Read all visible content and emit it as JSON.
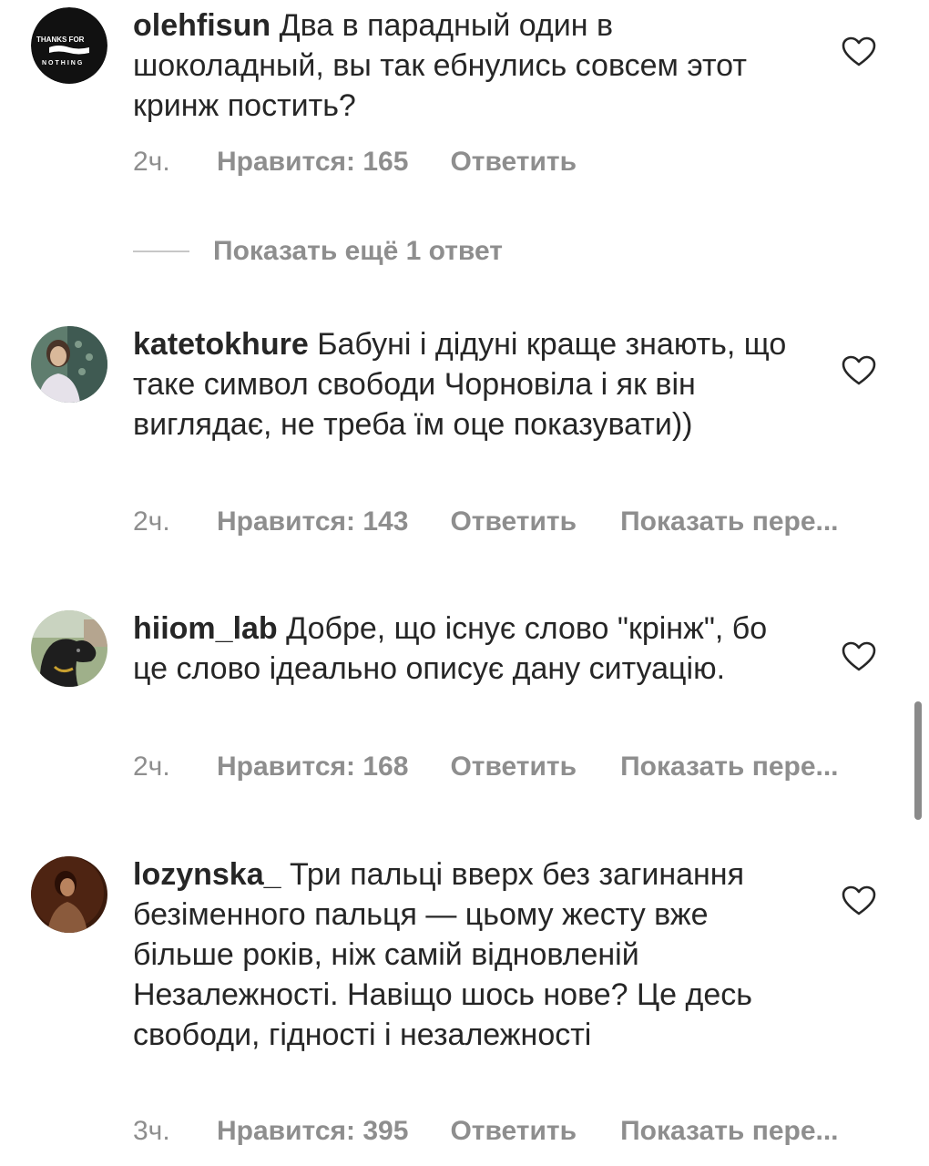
{
  "comments": [
    {
      "username": "olehfisun",
      "text": "Два в парадный один в шоколадный, вы так ебнулись совсем этот кринж постить?",
      "avatar_text_top": "THANKS FOR",
      "avatar_text_bottom": "NOTHING",
      "time": "2ч.",
      "likes": "Нравится: 165",
      "reply": "Ответить",
      "translate": ""
    },
    {
      "username": "katetokhure",
      "text": "Бабуні і дідуні краще знають, що таке символ свободи Чорновіла і як він виглядає, не треба їм оце показувати))",
      "time": "2ч.",
      "likes": "Нравится: 143",
      "reply": "Ответить",
      "translate": "Показать пере..."
    },
    {
      "username": "hiiom_lab",
      "text": "Добре, що існує слово \"крінж\", бо це слово ідеально описує дану ситуацію.",
      "time": "2ч.",
      "likes": "Нравится: 168",
      "reply": "Ответить",
      "translate": "Показать пере..."
    },
    {
      "username": "lozynska_",
      "text": "Три пальці вверх без загинання безіменного пальця — цьому жесту вже більше років, ніж самій відновленій Незалежності. Навіщо шось нове? Це десь свободи, гідності і незалежності",
      "time": "3ч.",
      "likes": "Нравится: 395",
      "reply": "Ответить",
      "translate": "Показать пере..."
    }
  ],
  "more_replies": {
    "label": "Показать ещё 1 ответ"
  },
  "colors": {
    "text": "#262626",
    "secondary": "#8e8e8e",
    "divider": "#c7c7c7"
  },
  "icons": {
    "like": "heart-outline-icon"
  }
}
